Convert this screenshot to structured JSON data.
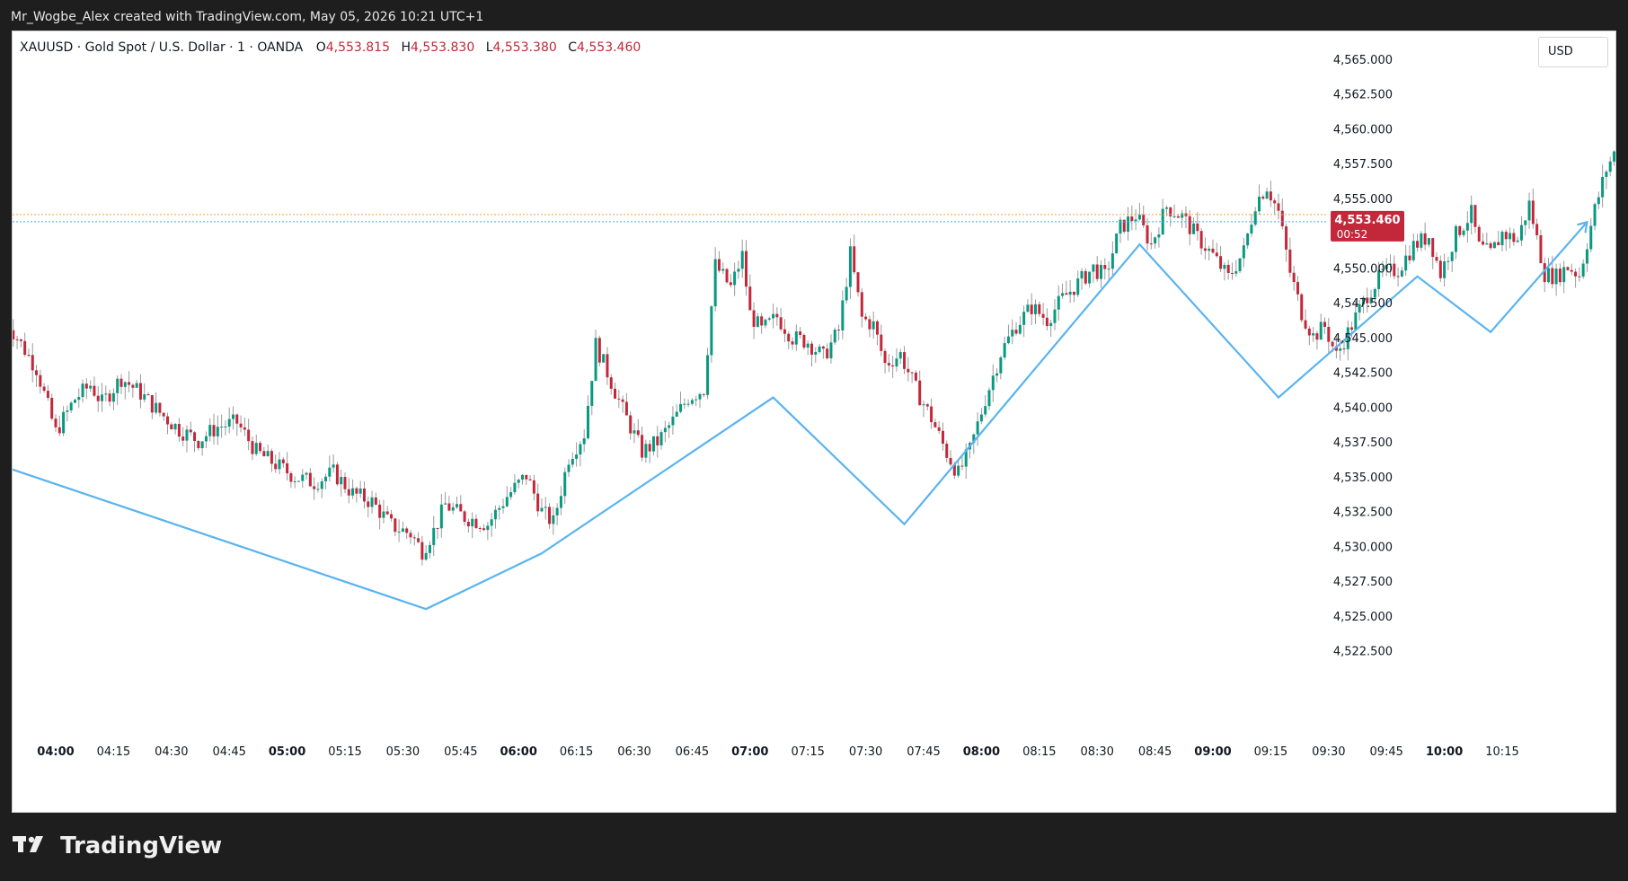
{
  "header": {
    "watermark": "Mr_Wogbe_Alex created with TradingView.com, May 05, 2026 10:21 UTC+1"
  },
  "legend": {
    "symbol": "XAUUSD · Gold Spot / U.S. Dollar · 1 · OANDA",
    "open_label": "O",
    "open": "4,553.815",
    "high_label": "H",
    "high": "4,553.830",
    "low_label": "L",
    "low": "4,553.380",
    "close_label": "C",
    "close": "4,553.460"
  },
  "currency_button": "USD",
  "price_tag": {
    "price": "4,553.460",
    "countdown": "00:52"
  },
  "footer": {
    "brand": "TradingView"
  },
  "colors": {
    "up": "#089981",
    "down": "#c3273a",
    "line": "#5ab4f0",
    "price_tag": "#c3273a",
    "grid_text": "#131722"
  },
  "chart_data": {
    "type": "candlestick",
    "y_axis": {
      "ticks": [
        4522.5,
        4525,
        4527.5,
        4530,
        4532.5,
        4535,
        4537.5,
        4540,
        4542.5,
        4545,
        4547.5,
        4550,
        4552.5,
        4555,
        4557.5,
        4560,
        4562.5,
        4565
      ],
      "tick_labels": [
        "4,522.500",
        "4,525.000",
        "4,527.500",
        "4,530.000",
        "4,532.500",
        "4,535.000",
        "4,537.500",
        "4,540.000",
        "4,542.500",
        "4,545.000",
        "4,547.500",
        "4,550.000",
        "4,552.500",
        "4,555.000",
        "4,557.500",
        "4,560.000",
        "4,562.500",
        "4,565.000"
      ],
      "range": [
        4520.8,
        4567.0
      ]
    },
    "x_axis": {
      "labels": [
        "04:00",
        "04:15",
        "04:30",
        "04:45",
        "05:00",
        "05:15",
        "05:30",
        "05:45",
        "06:00",
        "06:15",
        "06:30",
        "06:45",
        "07:00",
        "07:15",
        "07:30",
        "07:45",
        "08:00",
        "08:15",
        "08:30",
        "08:45",
        "09:00",
        "09:15",
        "09:30",
        "09:45",
        "10:00",
        "10:15"
      ],
      "bold": [
        "04:00",
        "05:00",
        "06:00",
        "07:00",
        "08:00",
        "09:00",
        "10:00"
      ],
      "range_minutes": [
        -15,
        384
      ]
    },
    "current_price": 4553.46,
    "candle_close_path": [
      [
        -13,
        4546.3
      ],
      [
        -5,
        4542.8
      ],
      [
        0,
        4538.2
      ],
      [
        5,
        4540.6
      ],
      [
        9,
        4541.6
      ],
      [
        12,
        4540.3
      ],
      [
        17,
        4542.1
      ],
      [
        22,
        4541.0
      ],
      [
        27,
        4539.6
      ],
      [
        32,
        4538.4
      ],
      [
        37,
        4537.6
      ],
      [
        42,
        4538.6
      ],
      [
        47,
        4538.9
      ],
      [
        52,
        4536.8
      ],
      [
        57,
        4535.9
      ],
      [
        62,
        4535.0
      ],
      [
        67,
        4534.6
      ],
      [
        72,
        4535.3
      ],
      [
        77,
        4533.8
      ],
      [
        82,
        4533.2
      ],
      [
        87,
        4531.5
      ],
      [
        92,
        4530.9
      ],
      [
        95,
        4529.7
      ],
      [
        98,
        4531.1
      ],
      [
        101,
        4533.0
      ],
      [
        106,
        4532.1
      ],
      [
        112,
        4531.6
      ],
      [
        117,
        4533.6
      ],
      [
        122,
        4535.1
      ],
      [
        126,
        4532.5
      ],
      [
        129,
        4531.7
      ],
      [
        133,
        4536.4
      ],
      [
        137,
        4538.1
      ],
      [
        140,
        4544.5
      ],
      [
        143,
        4542.5
      ],
      [
        147,
        4539.8
      ],
      [
        152,
        4536.8
      ],
      [
        156,
        4537.5
      ],
      [
        160,
        4539.0
      ],
      [
        164,
        4540.7
      ],
      [
        168,
        4541.3
      ],
      [
        171,
        4550.2
      ],
      [
        175,
        4548.6
      ],
      [
        178,
        4550.9
      ],
      [
        180,
        4546.7
      ],
      [
        183,
        4545.5
      ],
      [
        187,
        4546.5
      ],
      [
        191,
        4545.0
      ],
      [
        195,
        4544.7
      ],
      [
        199,
        4543.6
      ],
      [
        203,
        4545.5
      ],
      [
        206,
        4551.0
      ],
      [
        209,
        4546.4
      ],
      [
        212,
        4545.9
      ],
      [
        215,
        4543.1
      ],
      [
        219,
        4543.8
      ],
      [
        223,
        4541.3
      ],
      [
        227,
        4539.2
      ],
      [
        231,
        4536.7
      ],
      [
        234,
        4535.2
      ],
      [
        237,
        4536.9
      ],
      [
        241,
        4540.6
      ],
      [
        245,
        4543.9
      ],
      [
        249,
        4545.9
      ],
      [
        253,
        4547.2
      ],
      [
        257,
        4546.3
      ],
      [
        261,
        4547.8
      ],
      [
        265,
        4548.9
      ],
      [
        269,
        4550.0
      ],
      [
        272,
        4549.4
      ],
      [
        276,
        4552.9
      ],
      [
        280,
        4553.8
      ],
      [
        284,
        4551.7
      ],
      [
        288,
        4554.4
      ],
      [
        292,
        4553.7
      ],
      [
        296,
        4552.2
      ],
      [
        300,
        4550.9
      ],
      [
        304,
        4549.3
      ],
      [
        308,
        4551.2
      ],
      [
        311,
        4554.7
      ],
      [
        314,
        4555.9
      ],
      [
        317,
        4554.0
      ],
      [
        320,
        4549.7
      ],
      [
        323,
        4546.8
      ],
      [
        326,
        4545.1
      ],
      [
        329,
        4545.8
      ],
      [
        332,
        4543.7
      ],
      [
        336,
        4545.9
      ],
      [
        340,
        4548.1
      ],
      [
        344,
        4549.6
      ],
      [
        348,
        4549.9
      ],
      [
        352,
        4551.6
      ],
      [
        356,
        4552.3
      ],
      [
        359,
        4549.6
      ],
      [
        363,
        4552.4
      ],
      [
        367,
        4553.9
      ],
      [
        369,
        4551.5
      ],
      [
        372,
        4551.0
      ],
      [
        375,
        4552.5
      ],
      [
        379,
        4552.0
      ],
      [
        382,
        4554.6
      ],
      [
        386,
        4549.6
      ],
      [
        389,
        4549.4
      ],
      [
        392,
        4550.1
      ],
      [
        395,
        4549.5
      ],
      [
        399,
        4554.2
      ],
      [
        402,
        4557.1
      ],
      [
        405,
        4558.8
      ],
      [
        408,
        4555.1
      ],
      [
        411,
        4554.0
      ],
      [
        414,
        4556.5
      ],
      [
        418,
        4559.4
      ],
      [
        421,
        4557.8
      ],
      [
        424,
        4555.7
      ],
      [
        427,
        4554.5
      ],
      [
        430,
        4553.46
      ]
    ],
    "zigzag": [
      [
        -12,
        4535.6
      ],
      [
        96,
        4525.5
      ],
      [
        126,
        4529.5
      ],
      [
        186,
        4540.7
      ],
      [
        220,
        4531.6
      ],
      [
        281,
        4551.7
      ],
      [
        317,
        4540.7
      ],
      [
        353,
        4549.4
      ],
      [
        372,
        4545.4
      ],
      [
        397,
        4553.3
      ]
    ]
  }
}
